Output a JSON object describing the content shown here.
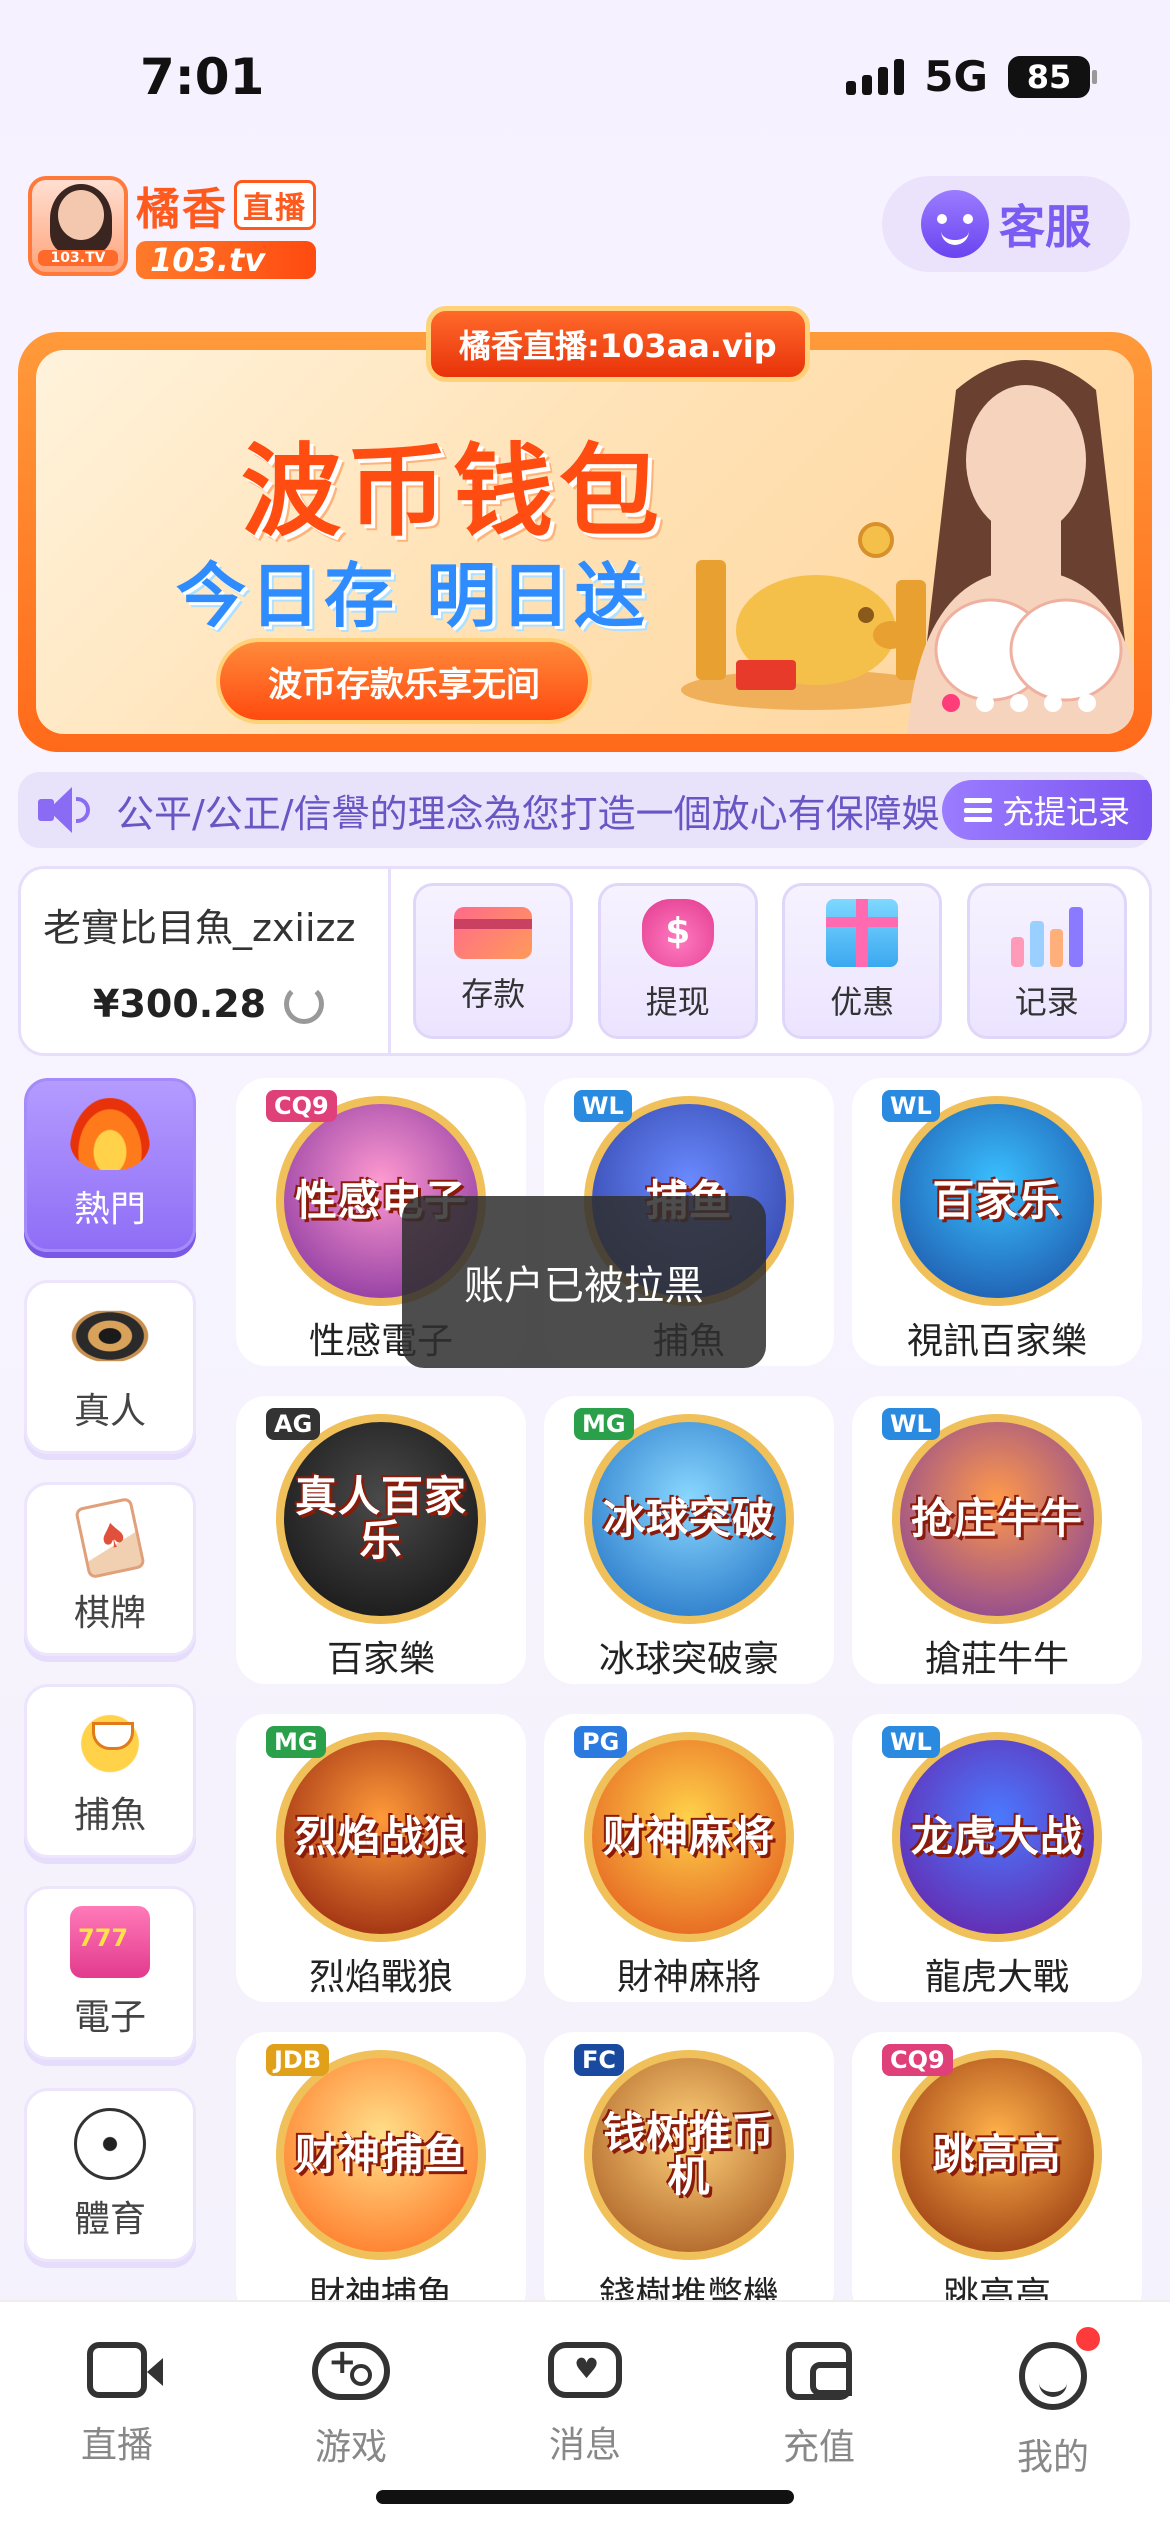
{
  "status_bar": {
    "time": "7:01",
    "network": "5G",
    "battery": "85"
  },
  "header": {
    "logo_cn": "橘香",
    "logo_live": "直播",
    "logo_domain": "103.tv",
    "logo_avatar_tag": "103.TV",
    "service_label": "客服"
  },
  "banner": {
    "domain_label": "橘香直播:103aa.vip",
    "title": "波币钱包",
    "subtitle": "今日存 明日送",
    "button_label": "波币存款乐享无间",
    "slide_count": 5,
    "active_slide": 0
  },
  "marquee": {
    "text": "公平/公正/信譽的理念為您打造一個放心有保障娛",
    "recharge_record_label": "充提记录"
  },
  "account": {
    "username": "老實比目魚_zxiizz",
    "balance": "¥300.28",
    "actions": [
      {
        "label": "存款",
        "icon": "card-icon"
      },
      {
        "label": "提现",
        "icon": "money-bag-icon"
      },
      {
        "label": "优惠",
        "icon": "gift-icon"
      },
      {
        "label": "记录",
        "icon": "bar-chart-icon"
      }
    ]
  },
  "sidenav": {
    "items": [
      {
        "label": "熱門",
        "icon": "fire-icon",
        "active": true
      },
      {
        "label": "真人",
        "icon": "casino-chip-icon",
        "active": false
      },
      {
        "label": "棋牌",
        "icon": "playing-card-icon",
        "active": false
      },
      {
        "label": "捕魚",
        "icon": "shark-icon",
        "active": false
      },
      {
        "label": "電子",
        "icon": "slot-machine-icon",
        "active": false
      },
      {
        "label": "體育",
        "icon": "soccer-ball-icon",
        "active": false
      }
    ]
  },
  "games": [
    {
      "name": "性感電子",
      "badge": "CQ9",
      "art": "性感电子",
      "colors": [
        "#ff9ad0",
        "#7a2a9a"
      ],
      "badge_color": "#e0407a"
    },
    {
      "name": "捕魚",
      "badge": "WL",
      "art": "捕鱼",
      "colors": [
        "#6a8aff",
        "#2a3a9a"
      ],
      "badge_color": "#2a8ae0"
    },
    {
      "name": "視訊百家樂",
      "badge": "WL",
      "art": "百家乐",
      "colors": [
        "#3ac0ff",
        "#1a4aa0"
      ],
      "badge_color": "#2a8ae0"
    },
    {
      "name": "百家樂",
      "badge": "AG",
      "art": "真人百家乐",
      "colors": [
        "#4a4a4a",
        "#111111"
      ],
      "badge_color": "#333333"
    },
    {
      "name": "冰球突破豪",
      "badge": "MG",
      "art": "冰球突破",
      "colors": [
        "#8ad8ff",
        "#1a6ac0"
      ],
      "badge_color": "#2aa04a"
    },
    {
      "name": "搶莊牛牛",
      "badge": "WL",
      "art": "抢庄牛牛",
      "colors": [
        "#ff9a4a",
        "#7a3aa0"
      ],
      "badge_color": "#2a8ae0"
    },
    {
      "name": "烈焰戰狼",
      "badge": "MG",
      "art": "烈焰战狼",
      "colors": [
        "#ff9a3a",
        "#8a1a0a"
      ],
      "badge_color": "#2aa04a"
    },
    {
      "name": "財神麻將",
      "badge": "PG",
      "art": "财神麻将",
      "colors": [
        "#ffd24a",
        "#e0501a"
      ],
      "badge_color": "#2a7ae0"
    },
    {
      "name": "龍虎大戰",
      "badge": "WL",
      "art": "龙虎大战",
      "colors": [
        "#4a7aff",
        "#6a1aa0"
      ],
      "badge_color": "#2a8ae0"
    },
    {
      "name": "財神捕魚",
      "badge": "JDB",
      "art": "财神捕鱼",
      "colors": [
        "#ffe08a",
        "#ff6a1a"
      ],
      "badge_color": "#e0a01a"
    },
    {
      "name": "錢樹推幣機",
      "badge": "FC",
      "art": "钱树推币机",
      "colors": [
        "#ffd27a",
        "#a0501a"
      ],
      "badge_color": "#1a4aa0"
    },
    {
      "name": "跳高高",
      "badge": "CQ9",
      "art": "跳高高",
      "colors": [
        "#ffb24a",
        "#8a2a0a"
      ],
      "badge_color": "#e0407a"
    }
  ],
  "toast": {
    "message": "账户已被拉黑"
  },
  "tabbar": {
    "items": [
      {
        "label": "直播",
        "icon": "video-camera-icon",
        "badge": false
      },
      {
        "label": "游戏",
        "icon": "gamepad-icon",
        "badge": false
      },
      {
        "label": "消息",
        "icon": "message-icon",
        "badge": false
      },
      {
        "label": "充值",
        "icon": "wallet-icon",
        "badge": false
      },
      {
        "label": "我的",
        "icon": "smiley-face-icon",
        "badge": true
      }
    ]
  },
  "colors": {
    "accent": "#8f6ef6",
    "brand_orange": "#ff5a1e",
    "notification": "#ff3a3a"
  }
}
